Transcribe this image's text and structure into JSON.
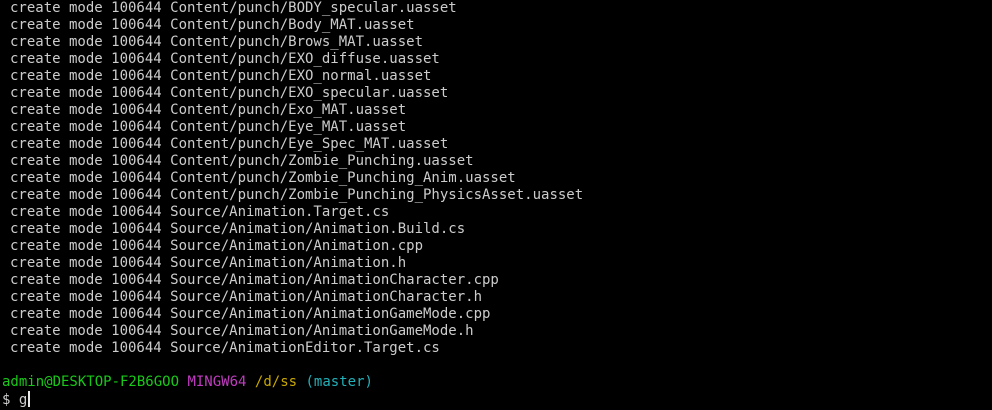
{
  "output_lines": [
    "create mode 100644 Content/punch/BODY_specular.uasset",
    "create mode 100644 Content/punch/Body_MAT.uasset",
    "create mode 100644 Content/punch/Brows_MAT.uasset",
    "create mode 100644 Content/punch/EXO_diffuse.uasset",
    "create mode 100644 Content/punch/EXO_normal.uasset",
    "create mode 100644 Content/punch/EXO_specular.uasset",
    "create mode 100644 Content/punch/Exo_MAT.uasset",
    "create mode 100644 Content/punch/Eye_MAT.uasset",
    "create mode 100644 Content/punch/Eye_Spec_MAT.uasset",
    "create mode 100644 Content/punch/Zombie_Punching.uasset",
    "create mode 100644 Content/punch/Zombie_Punching_Anim.uasset",
    "create mode 100644 Content/punch/Zombie_Punching_PhysicsAsset.uasset",
    "create mode 100644 Source/Animation.Target.cs",
    "create mode 100644 Source/Animation/Animation.Build.cs",
    "create mode 100644 Source/Animation/Animation.cpp",
    "create mode 100644 Source/Animation/Animation.h",
    "create mode 100644 Source/Animation/AnimationCharacter.cpp",
    "create mode 100644 Source/Animation/AnimationCharacter.h",
    "create mode 100644 Source/Animation/AnimationGameMode.cpp",
    "create mode 100644 Source/Animation/AnimationGameMode.h",
    "create mode 100644 Source/AnimationEditor.Target.cs"
  ],
  "prompt": {
    "user_host": "admin@DESKTOP-F2B6GOO",
    "shell": "MINGW64",
    "path": "/d/ss",
    "branch": "(master)"
  },
  "command": {
    "symbol": "$",
    "typed": "g"
  },
  "colors": {
    "background": "#000000",
    "text": "#cccccc",
    "user_host": "#19c919",
    "shell": "#c03cc0",
    "path": "#c8a800",
    "branch": "#22b0b8"
  }
}
